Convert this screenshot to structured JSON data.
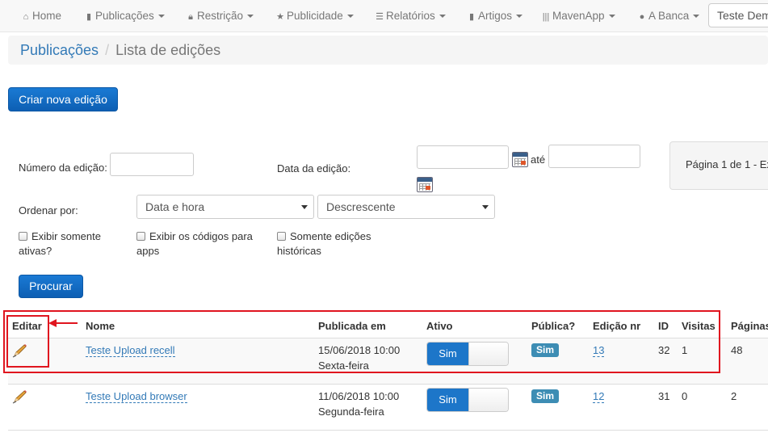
{
  "nav": {
    "items": [
      {
        "name": "home",
        "icon": "home-icon",
        "label": "Home",
        "dropdown": false
      },
      {
        "name": "publicacoes",
        "icon": "book-icon",
        "label": "Publicações",
        "dropdown": true
      },
      {
        "name": "restricao",
        "icon": "lock-icon",
        "label": "Restrição",
        "dropdown": true
      },
      {
        "name": "publicidade",
        "icon": "star-icon",
        "label": "Publicidade",
        "dropdown": true
      },
      {
        "name": "relatorios",
        "icon": "list-icon",
        "label": "Relatórios",
        "dropdown": true
      },
      {
        "name": "artigos",
        "icon": "bookmark-icon",
        "label": "Artigos",
        "dropdown": true
      },
      {
        "name": "mavenapp",
        "icon": "barcode-icon",
        "label": "MavenApp",
        "dropdown": true
      },
      {
        "name": "a-banca",
        "icon": "globe-icon",
        "label": "A Banca",
        "dropdown": true
      }
    ],
    "search_value": "Teste Dem"
  },
  "breadcrumb": {
    "parent": "Publicações",
    "current": "Lista de edições"
  },
  "create_button": "Criar nova edição",
  "filters": {
    "numero_label": "Número da edição:",
    "data_label": "Data da edição:",
    "ate_label": "até",
    "ordenar_label": "Ordenar por:",
    "order_by_selected": "Data e hora",
    "order_dir_selected": "Descrescente",
    "chk_ativas": "Exibir somente ativas?",
    "chk_codigos": "Exibir os códigos para apps",
    "chk_historicas": "Somente edições históricas",
    "search_button": "Procurar"
  },
  "pager_text": "Página 1 de 1 - Ex",
  "table": {
    "headers": {
      "editar": "Editar",
      "nome": "Nome",
      "publicada_em": "Publicada em",
      "ativo": "Ativo",
      "publica": "Pública?",
      "edicao_nr": "Edição nr",
      "id": "ID",
      "visitas": "Visitas",
      "paginas": "Páginas"
    },
    "rows": [
      {
        "nome": "Teste Upload recell",
        "data": "15/06/2018 10:00",
        "dia": "Sexta-feira",
        "ativo": "Sim",
        "publica": "Sim",
        "edicao": "13",
        "id": "32",
        "visitas": "1",
        "paginas": "48"
      },
      {
        "nome": "Teste Upload browser",
        "data": "11/06/2018 10:00",
        "dia": "Segunda-feira",
        "ativo": "Sim",
        "publica": "Sim",
        "edicao": "12",
        "id": "31",
        "visitas": "0",
        "paginas": "2"
      }
    ]
  },
  "colors": {
    "primary": "#1a7ad4",
    "link": "#337ab7",
    "badge": "#3d8db4",
    "highlight": "#e0151f"
  }
}
